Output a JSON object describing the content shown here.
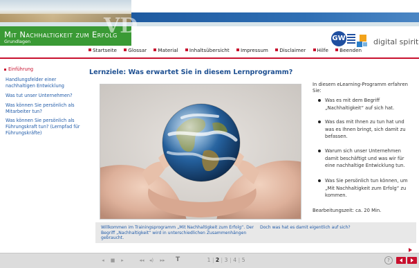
{
  "header": {
    "course_title": "Mit Nachhaltigkeit zum Erfolg",
    "course_subtitle": "Grundlagen",
    "watermark": "VD",
    "logo_left_text": "GW",
    "logo_right_text": "digital spirit"
  },
  "nav": {
    "items": [
      "Startseite",
      "Glossar",
      "Material",
      "Inhaltsübersicht",
      "Impressum",
      "Disclaimer",
      "Hilfe",
      "Beenden"
    ]
  },
  "sidebar": {
    "items": [
      "Einführung",
      "Handlungsfelder einer nachhaltigen Entwicklung",
      "Was tut unser Unternehmen?",
      "Was können Sie persönlich als Mitarbeiter tun?",
      "Was können Sie persönlich als Führungskraft tun? (Lernpfad für Führungskräfte)"
    ],
    "active_index": 0
  },
  "main": {
    "title": "Lernziele: Was erwartet Sie in diesem Lernprogramm?",
    "image_alt": "Hände halten Erdkugel",
    "intro": "In diesem eLearning-Programm erfahren Sie:",
    "bullets": [
      "Was es mit dem Begriff „Nachhaltigkeit“ auf sich hat.",
      "Was das mit Ihnen zu tun hat und was es Ihnen bringt, sich damit zu befassen.",
      "Warum sich unser Unternehmen damit beschäftigt und was wir für eine nachhaltige Entwicklung tun.",
      "Was Sie persönlich tun können, um „Mit Nachhaltigkeit zum Erfolg“ zu kommen."
    ],
    "duration": "Bearbeitungszeit: ca. 20 Min."
  },
  "info_strip": {
    "left": "Willkommen im Trainingsprogramm „Mit Nachhaltigkeit zum Erfolg“. Der Begriff „Nachhaltigkeit“ wird in unterschiedlichen Zusammenhängen gebraucht.",
    "right": "Doch was hat es damit eigentlich auf sich?"
  },
  "footer": {
    "controls": [
      "◂",
      "■",
      "▸",
      "",
      "◂◂",
      "◂)",
      "▸▸"
    ],
    "font_label": "T",
    "pages": [
      "1",
      "2",
      "3",
      "4",
      "5"
    ],
    "current_page": "2",
    "help_label": "?"
  },
  "colors": {
    "accent_red": "#c8102e",
    "brand_green": "#3a9a35",
    "brand_blue": "#1d4f91",
    "link_blue": "#1f5aa8"
  }
}
